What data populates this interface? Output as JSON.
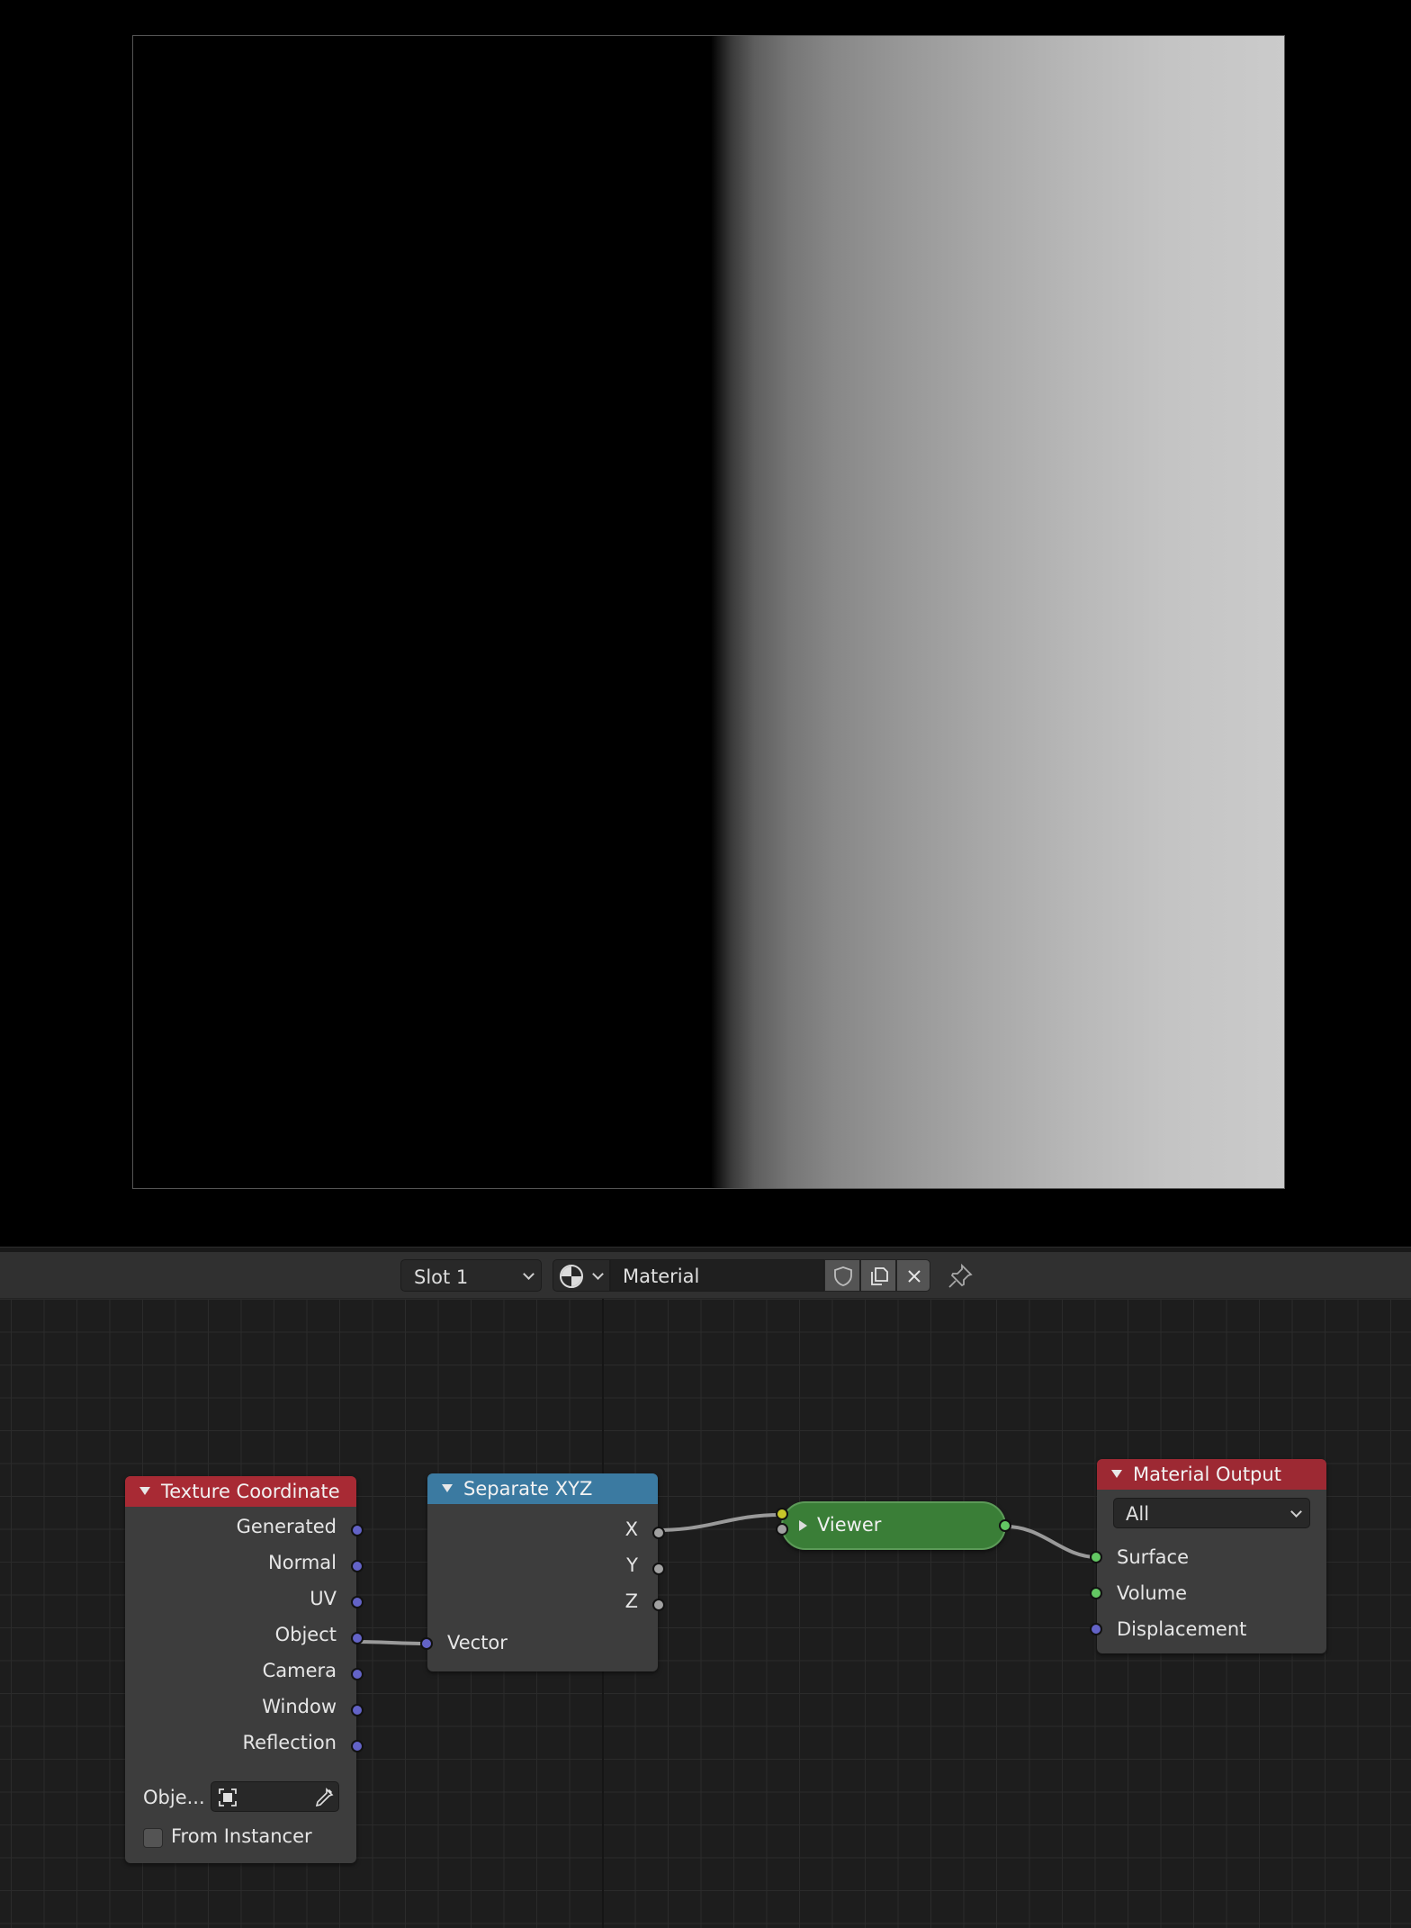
{
  "header": {
    "slot_label": "Slot 1",
    "material_name": "Material",
    "icons": [
      "material-ball-icon",
      "shield-icon",
      "duplicate-icon",
      "close-icon",
      "pin-icon"
    ]
  },
  "nodes": {
    "texture_coordinate": {
      "title": "Texture Coordinate",
      "color": "#a82a34",
      "outputs": [
        "Generated",
        "Normal",
        "UV",
        "Object",
        "Camera",
        "Window",
        "Reflection"
      ],
      "object_label": "Obje...",
      "from_instancer_label": "From Instancer",
      "from_instancer_checked": false
    },
    "separate_xyz": {
      "title": "Separate XYZ",
      "color": "#3b7aa1",
      "outputs": [
        "X",
        "Y",
        "Z"
      ],
      "inputs": [
        "Vector"
      ]
    },
    "viewer": {
      "title": "Viewer",
      "color": "#3a7e37"
    },
    "material_output": {
      "title": "Material Output",
      "color": "#9d2933",
      "target": "All",
      "inputs": [
        "Surface",
        "Volume",
        "Displacement"
      ]
    }
  },
  "socket_colors": {
    "vector": "#6363c7",
    "float": "#a1a1a1",
    "shader": "#63c763"
  }
}
